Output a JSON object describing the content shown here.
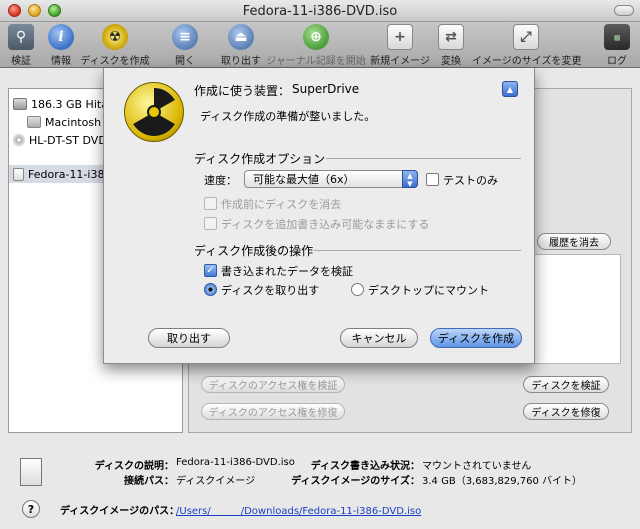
{
  "window": {
    "title": "Fedora-11-i386-DVD.iso"
  },
  "toolbar": {
    "items": [
      {
        "label": "検証",
        "icon": "microscope-icon"
      },
      {
        "label": "情報",
        "icon": "info-icon"
      },
      {
        "label": "ディスクを作成",
        "icon": "burn-icon"
      },
      {
        "label": "開く",
        "icon": "open-icon"
      },
      {
        "label": "取り出す",
        "icon": "eject-icon"
      },
      {
        "label": "ジャーナル記録を開始",
        "icon": "journal-icon"
      },
      {
        "label": "新規イメージ",
        "icon": "new-image-icon"
      },
      {
        "label": "変換",
        "icon": "convert-icon"
      },
      {
        "label": "イメージのサイズを変更",
        "icon": "resize-image-icon"
      },
      {
        "label": "ログ",
        "icon": "log-icon",
        "icon_text": "WARN\n13:24"
      }
    ]
  },
  "sidebar": {
    "items": [
      {
        "label": "186.3 GB Hitac"
      },
      {
        "label": "Macintosh H"
      },
      {
        "label": "HL-DT-ST DVD"
      },
      {
        "label": "Fedora-11-i38"
      }
    ]
  },
  "main": {
    "history_clear": "履歴を消去",
    "verify_permissions": "ディスクのアクセス権を検証",
    "repair_permissions": "ディスクのアクセス権を修復",
    "verify_disk": "ディスクを検証",
    "repair_disk": "ディスクを修復"
  },
  "info": {
    "desc_label": "ディスクの説明：",
    "desc_value": "Fedora-11-i386-DVD.iso",
    "conn_label": "接続パス：",
    "conn_value": "ディスクイメージ",
    "write_label": "ディスク書き込み状況：",
    "write_value": "マウントされていません",
    "size_label": "ディスクイメージのサイズ：",
    "size_value": "3.4 GB（3,683,829,760 バイト）",
    "path_label": "ディスクイメージのパス：",
    "path_value": "/Users/　　　/Downloads/Fedora-11-i386-DVD.iso",
    "help": "?"
  },
  "sheet": {
    "device_label": "作成に使う装置：",
    "device_value": "SuperDrive",
    "status": "ディスク作成の準備が整いました。",
    "options_title": "ディスク作成オプション",
    "speed_label": "速度：",
    "speed_value": "可能な最大値（6x）",
    "test_only": "テストのみ",
    "erase_before": "作成前にディスクを消去",
    "keep_appendable": "ディスクを追加書き込み可能なままにする",
    "after_title": "ディスク作成後の操作",
    "verify_written": "書き込まれたデータを検証",
    "eject_disk": "ディスクを取り出す",
    "mount_desktop": "デスクトップにマウント",
    "eject_button": "取り出す",
    "cancel_button": "キャンセル",
    "burn_button": "ディスクを作成"
  }
}
